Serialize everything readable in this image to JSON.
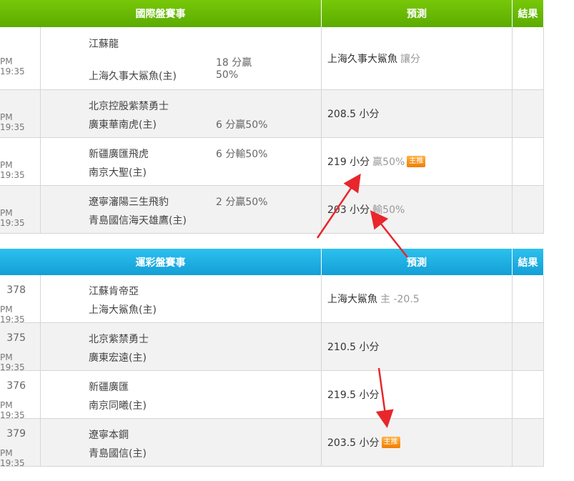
{
  "intl": {
    "header": {
      "match": "國際盤賽事",
      "prediction": "預測",
      "result": "結果"
    },
    "rows": [
      {
        "time": "PM 19:35",
        "away": "江蘇龍",
        "home": "上海久事大鯊魚(主)",
        "line1": "18 分贏",
        "line2": "50%",
        "pred": "上海久事大鯊魚",
        "pred_extra": "讓分",
        "badge": ""
      },
      {
        "time": "PM 19:35",
        "away": "北京控股紫禁勇士",
        "home": "廣東華南虎(主)",
        "line1": "6 分贏50%",
        "line2": "",
        "pred": "208.5 小分",
        "pred_extra": "",
        "badge": ""
      },
      {
        "time": "PM 19:35",
        "away": "新疆廣匯飛虎",
        "home": "南京大聖(主)",
        "line1": "6 分輸50%",
        "line2": "",
        "pred": "219 小分",
        "pred_extra": "贏50%",
        "badge": "主推"
      },
      {
        "time": "PM 19:35",
        "away": "遼寧瀋陽三生飛豹",
        "home": "青島國信海天雄鷹(主)",
        "line1": "2 分贏50%",
        "line2": "",
        "pred": "203 小分",
        "pred_extra": "輸50%",
        "badge": ""
      }
    ]
  },
  "lottery": {
    "header": {
      "match": "運彩盤賽事",
      "prediction": "預測",
      "result": "結果"
    },
    "rows": [
      {
        "num": "378",
        "time": "PM 19:35",
        "away": "江蘇肯帝亞",
        "home": "上海大鯊魚(主)",
        "pred": "上海大鯊魚",
        "pred_extra": "主 -20.5",
        "badge": ""
      },
      {
        "num": "375",
        "time": "PM 19:35",
        "away": "北京紫禁勇士",
        "home": "廣東宏遠(主)",
        "pred": "210.5 小分",
        "pred_extra": "",
        "badge": ""
      },
      {
        "num": "376",
        "time": "PM 19:35",
        "away": "新疆廣匯",
        "home": "南京同曦(主)",
        "pred": "219.5 小分",
        "pred_extra": "",
        "badge": ""
      },
      {
        "num": "379",
        "time": "PM 19:35",
        "away": "遼寧本鋼",
        "home": "青島國信(主)",
        "pred": "203.5 小分",
        "pred_extra": "",
        "badge": "主推"
      }
    ]
  },
  "colors": {
    "green_header": "#6bbd05",
    "blue_header": "#1aaee2",
    "badge": "#f39410",
    "arrow": "#e8262c"
  }
}
